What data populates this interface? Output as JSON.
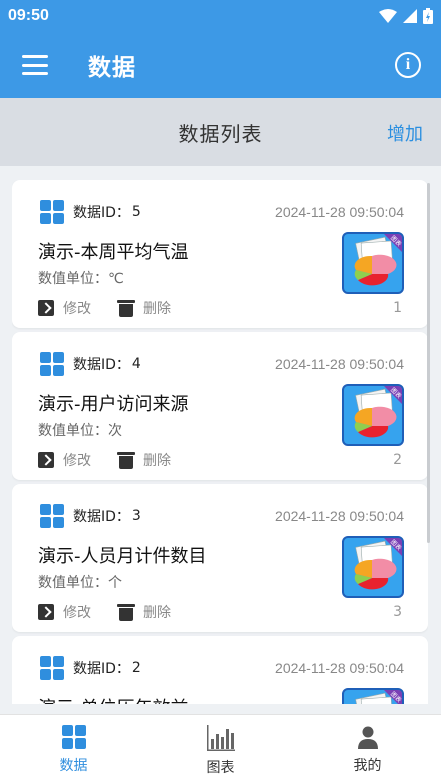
{
  "status_bar": {
    "time": "09:50"
  },
  "app_bar": {
    "title": "数据"
  },
  "section": {
    "title": "数据列表",
    "add_label": "增加"
  },
  "colors": {
    "accent": "#3d99e6",
    "link": "#2b8fe0",
    "icon_blue": "#2f8ede"
  },
  "labels": {
    "id_prefix": "数据ID：",
    "unit_prefix": "数值单位：",
    "edit": "修改",
    "delete": "删除"
  },
  "records": [
    {
      "id": "5",
      "timestamp": "2024-11-28 09:50:04",
      "title": "演示-本周平均气温",
      "unit": "℃",
      "index": "1"
    },
    {
      "id": "4",
      "timestamp": "2024-11-28 09:50:04",
      "title": "演示-用户访问来源",
      "unit": "次",
      "index": "2"
    },
    {
      "id": "3",
      "timestamp": "2024-11-28 09:50:04",
      "title": "演示-人员月计件数目",
      "unit": "个",
      "index": "3"
    },
    {
      "id": "2",
      "timestamp": "2024-11-28 09:50:04",
      "title": "演示-单位历年效益",
      "unit": "",
      "index": ""
    }
  ],
  "thumbnail_badge": "图表",
  "bottom_nav": [
    {
      "label": "数据",
      "icon": "grid-icon",
      "active": true
    },
    {
      "label": "图表",
      "icon": "bar-chart-icon",
      "active": false
    },
    {
      "label": "我的",
      "icon": "person-icon",
      "active": false
    }
  ]
}
